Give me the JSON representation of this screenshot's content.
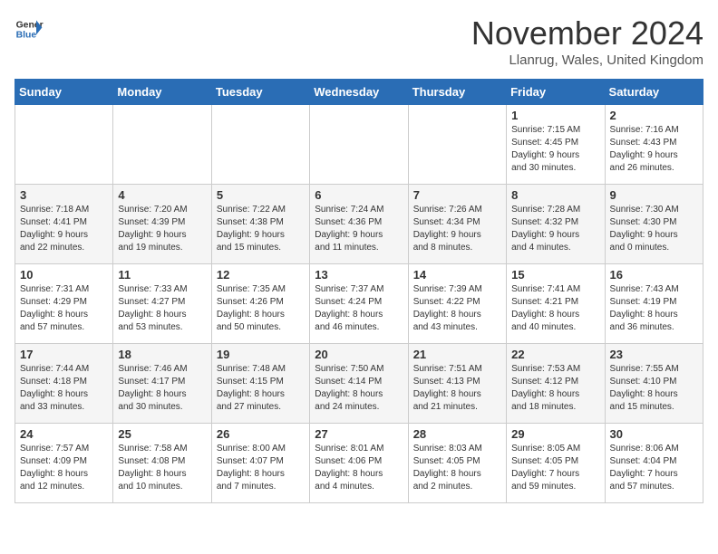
{
  "header": {
    "logo_line1": "General",
    "logo_line2": "Blue",
    "month_title": "November 2024",
    "location": "Llanrug, Wales, United Kingdom"
  },
  "weekdays": [
    "Sunday",
    "Monday",
    "Tuesday",
    "Wednesday",
    "Thursday",
    "Friday",
    "Saturday"
  ],
  "weeks": [
    [
      {
        "day": "",
        "info": ""
      },
      {
        "day": "",
        "info": ""
      },
      {
        "day": "",
        "info": ""
      },
      {
        "day": "",
        "info": ""
      },
      {
        "day": "",
        "info": ""
      },
      {
        "day": "1",
        "info": "Sunrise: 7:15 AM\nSunset: 4:45 PM\nDaylight: 9 hours\nand 30 minutes."
      },
      {
        "day": "2",
        "info": "Sunrise: 7:16 AM\nSunset: 4:43 PM\nDaylight: 9 hours\nand 26 minutes."
      }
    ],
    [
      {
        "day": "3",
        "info": "Sunrise: 7:18 AM\nSunset: 4:41 PM\nDaylight: 9 hours\nand 22 minutes."
      },
      {
        "day": "4",
        "info": "Sunrise: 7:20 AM\nSunset: 4:39 PM\nDaylight: 9 hours\nand 19 minutes."
      },
      {
        "day": "5",
        "info": "Sunrise: 7:22 AM\nSunset: 4:38 PM\nDaylight: 9 hours\nand 15 minutes."
      },
      {
        "day": "6",
        "info": "Sunrise: 7:24 AM\nSunset: 4:36 PM\nDaylight: 9 hours\nand 11 minutes."
      },
      {
        "day": "7",
        "info": "Sunrise: 7:26 AM\nSunset: 4:34 PM\nDaylight: 9 hours\nand 8 minutes."
      },
      {
        "day": "8",
        "info": "Sunrise: 7:28 AM\nSunset: 4:32 PM\nDaylight: 9 hours\nand 4 minutes."
      },
      {
        "day": "9",
        "info": "Sunrise: 7:30 AM\nSunset: 4:30 PM\nDaylight: 9 hours\nand 0 minutes."
      }
    ],
    [
      {
        "day": "10",
        "info": "Sunrise: 7:31 AM\nSunset: 4:29 PM\nDaylight: 8 hours\nand 57 minutes."
      },
      {
        "day": "11",
        "info": "Sunrise: 7:33 AM\nSunset: 4:27 PM\nDaylight: 8 hours\nand 53 minutes."
      },
      {
        "day": "12",
        "info": "Sunrise: 7:35 AM\nSunset: 4:26 PM\nDaylight: 8 hours\nand 50 minutes."
      },
      {
        "day": "13",
        "info": "Sunrise: 7:37 AM\nSunset: 4:24 PM\nDaylight: 8 hours\nand 46 minutes."
      },
      {
        "day": "14",
        "info": "Sunrise: 7:39 AM\nSunset: 4:22 PM\nDaylight: 8 hours\nand 43 minutes."
      },
      {
        "day": "15",
        "info": "Sunrise: 7:41 AM\nSunset: 4:21 PM\nDaylight: 8 hours\nand 40 minutes."
      },
      {
        "day": "16",
        "info": "Sunrise: 7:43 AM\nSunset: 4:19 PM\nDaylight: 8 hours\nand 36 minutes."
      }
    ],
    [
      {
        "day": "17",
        "info": "Sunrise: 7:44 AM\nSunset: 4:18 PM\nDaylight: 8 hours\nand 33 minutes."
      },
      {
        "day": "18",
        "info": "Sunrise: 7:46 AM\nSunset: 4:17 PM\nDaylight: 8 hours\nand 30 minutes."
      },
      {
        "day": "19",
        "info": "Sunrise: 7:48 AM\nSunset: 4:15 PM\nDaylight: 8 hours\nand 27 minutes."
      },
      {
        "day": "20",
        "info": "Sunrise: 7:50 AM\nSunset: 4:14 PM\nDaylight: 8 hours\nand 24 minutes."
      },
      {
        "day": "21",
        "info": "Sunrise: 7:51 AM\nSunset: 4:13 PM\nDaylight: 8 hours\nand 21 minutes."
      },
      {
        "day": "22",
        "info": "Sunrise: 7:53 AM\nSunset: 4:12 PM\nDaylight: 8 hours\nand 18 minutes."
      },
      {
        "day": "23",
        "info": "Sunrise: 7:55 AM\nSunset: 4:10 PM\nDaylight: 8 hours\nand 15 minutes."
      }
    ],
    [
      {
        "day": "24",
        "info": "Sunrise: 7:57 AM\nSunset: 4:09 PM\nDaylight: 8 hours\nand 12 minutes."
      },
      {
        "day": "25",
        "info": "Sunrise: 7:58 AM\nSunset: 4:08 PM\nDaylight: 8 hours\nand 10 minutes."
      },
      {
        "day": "26",
        "info": "Sunrise: 8:00 AM\nSunset: 4:07 PM\nDaylight: 8 hours\nand 7 minutes."
      },
      {
        "day": "27",
        "info": "Sunrise: 8:01 AM\nSunset: 4:06 PM\nDaylight: 8 hours\nand 4 minutes."
      },
      {
        "day": "28",
        "info": "Sunrise: 8:03 AM\nSunset: 4:05 PM\nDaylight: 8 hours\nand 2 minutes."
      },
      {
        "day": "29",
        "info": "Sunrise: 8:05 AM\nSunset: 4:05 PM\nDaylight: 7 hours\nand 59 minutes."
      },
      {
        "day": "30",
        "info": "Sunrise: 8:06 AM\nSunset: 4:04 PM\nDaylight: 7 hours\nand 57 minutes."
      }
    ]
  ]
}
